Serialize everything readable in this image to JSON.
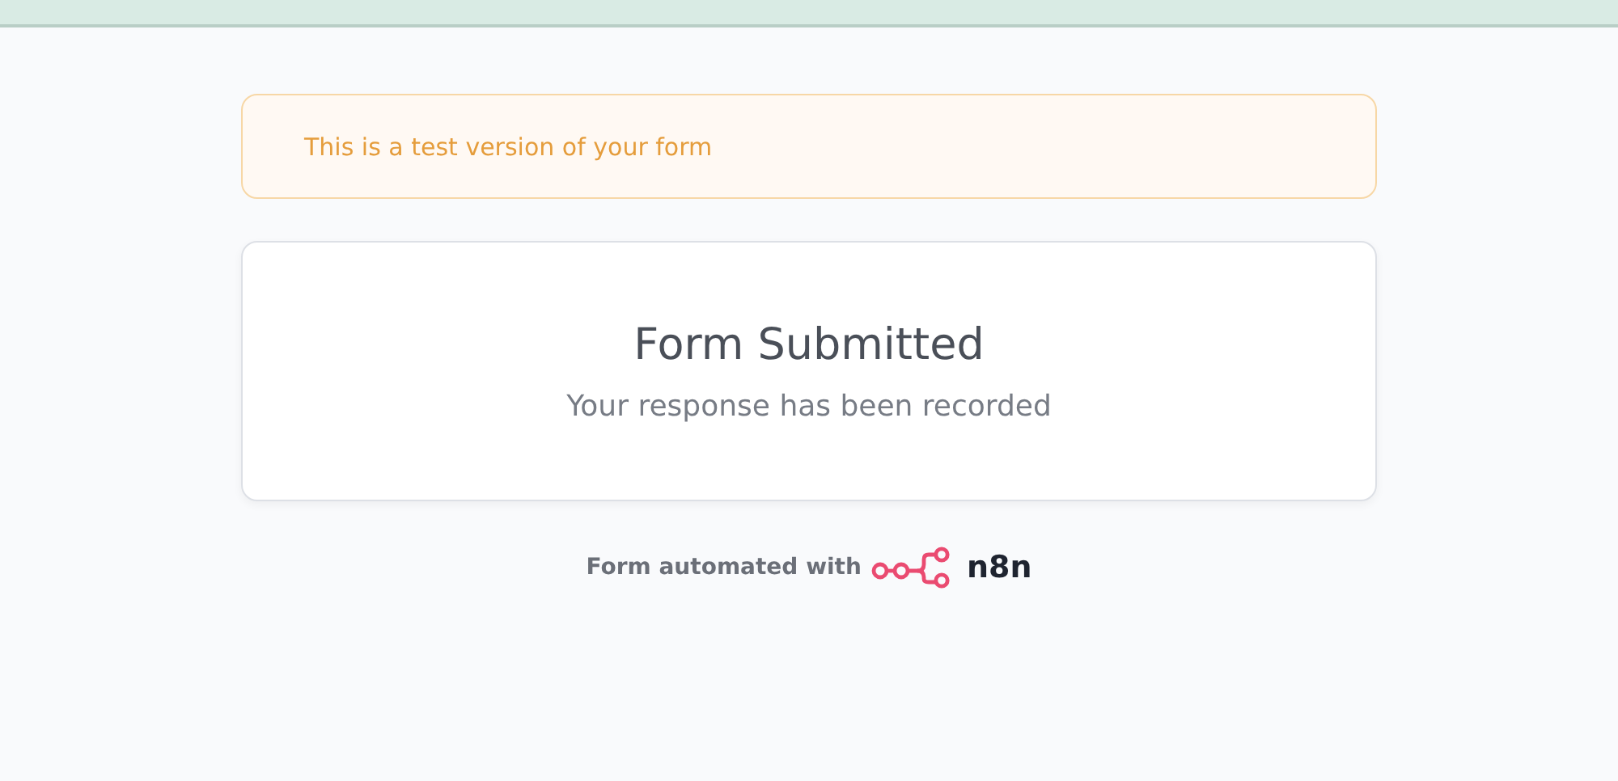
{
  "notice": {
    "text": "This is a test version of your form"
  },
  "card": {
    "title": "Form Submitted",
    "message": "Your response has been recorded"
  },
  "footer": {
    "text": "Form automated with",
    "brand": "n8n"
  }
}
